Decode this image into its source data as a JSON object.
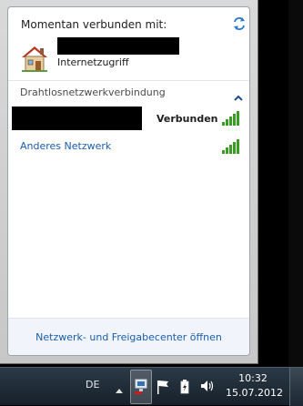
{
  "flyout": {
    "connected_title": "Momentan verbunden mit:",
    "network_type": "Internetzugriff",
    "section_header": "Drahtlosnetzwerkverbindung",
    "connected_status": "Verbunden",
    "other_network": "Anderes Netzwerk",
    "footer_link": "Netzwerk- und Freigabecenter öffnen",
    "icons": [
      "refresh-icon",
      "house-network-icon",
      "collapse-chevron-icon",
      "signal-strength-icon"
    ]
  },
  "taskbar": {
    "language": "DE",
    "clock_time": "10:32",
    "clock_date": "15.07.2012",
    "icons": [
      "show-hidden-icons-arrow",
      "network-tray-icon",
      "action-center-flag-icon",
      "power-icon",
      "volume-icon"
    ]
  },
  "colors": {
    "link": "#1a5dab",
    "signal_green": "#3a9d23",
    "taskbar": "#1c2731"
  }
}
